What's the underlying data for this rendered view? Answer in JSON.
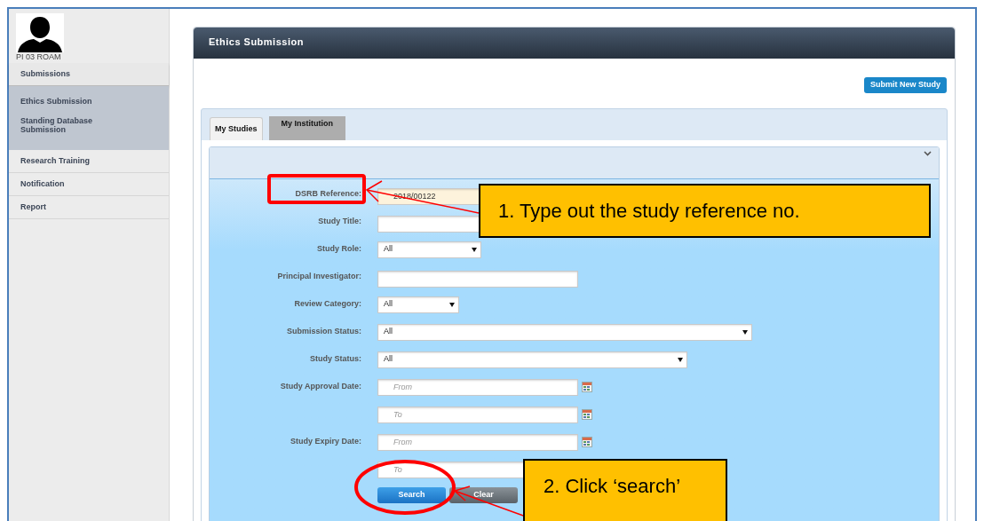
{
  "user": {
    "name": "PI 03 ROAM"
  },
  "sidebar": {
    "items": [
      {
        "label": "Submissions",
        "expanded": true,
        "children": [
          {
            "label": "Ethics Submission"
          },
          {
            "label": "Standing Database Submission"
          }
        ]
      },
      {
        "label": "Research Training",
        "expanded": false
      },
      {
        "label": "Notification",
        "expanded": false
      },
      {
        "label": "Report",
        "expanded": false
      }
    ]
  },
  "panel": {
    "title": "Ethics Submission",
    "action_button": "Submit New Study"
  },
  "tabs": [
    {
      "label": "My Studies",
      "selected": true
    },
    {
      "label": "My Institution",
      "selected": false
    }
  ],
  "form": {
    "fields": [
      {
        "label": "DSRB Reference:",
        "kind": "text",
        "value": "2018/00122",
        "focused": true
      },
      {
        "label": "Study Title:",
        "kind": "text",
        "focused": false
      },
      {
        "label": "Study Role:",
        "kind": "select",
        "value": "All",
        "focused": false
      },
      {
        "label": "Principal Investigator:",
        "kind": "text",
        "focused": false
      },
      {
        "label": "Review Category:",
        "kind": "select",
        "value": "All",
        "focused": false
      },
      {
        "label": "Submission Status:",
        "kind": "select",
        "value": "All",
        "focused": false
      },
      {
        "label": "Study Status:",
        "kind": "select",
        "value": "All",
        "focused": false
      },
      {
        "label": "Study Approval Date:",
        "kind": "date",
        "placeholder": "From",
        "focused": false
      },
      {
        "kind": "date",
        "placeholder": "To",
        "focused": false
      },
      {
        "label": "Study Expiry Date:",
        "kind": "date",
        "placeholder": "From",
        "focused": false
      },
      {
        "kind": "date",
        "placeholder": "To",
        "focused": false
      }
    ],
    "buttons": [
      {
        "label": "Search",
        "kind": "primary"
      },
      {
        "label": "Clear",
        "kind": "secondary"
      }
    ]
  },
  "annotations": [
    {
      "text": "1. Type out the study reference no."
    },
    {
      "text": "2. Click ‘search’"
    }
  ]
}
